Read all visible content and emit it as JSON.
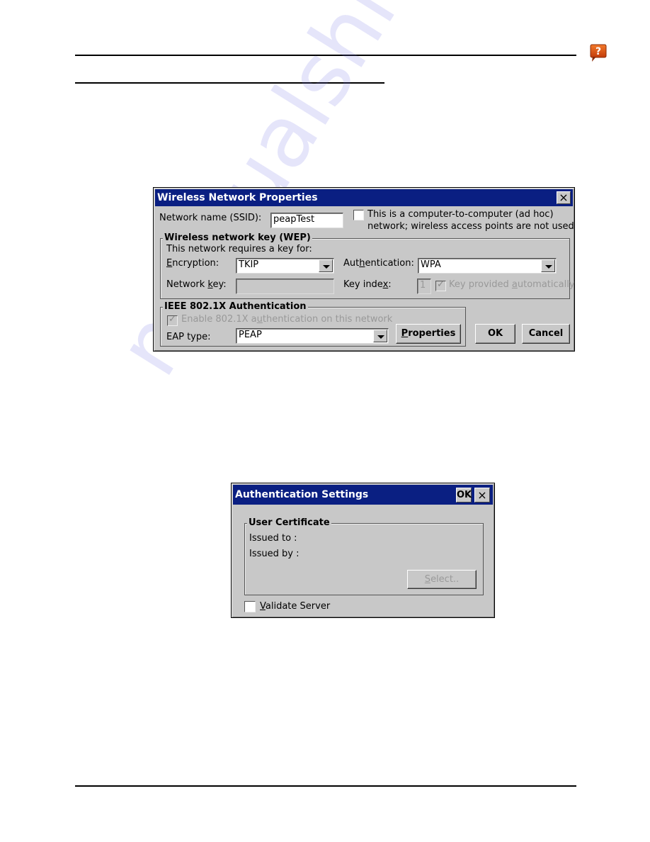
{
  "page": {
    "watermark": "manualshive.com",
    "help_icon": "help-question-icon"
  },
  "wireless_dialog": {
    "title": "Wireless Network Properties",
    "close_label": "×",
    "network_name_label": "Network name (SSID):",
    "network_name_value": "peapTest",
    "adhoc_checked": false,
    "adhoc_label_line1": "This is a computer-to-computer (ad hoc)",
    "adhoc_label_line2": "network; wireless access points are not used",
    "wep_group_title": "Wireless network key (WEP)",
    "requires_key_label": "This network requires a key for:",
    "encryption_label": "Encryption:",
    "encryption_value": "TKIP",
    "authentication_label": "Authentication:",
    "authentication_value": "WPA",
    "network_key_label": "Network key:",
    "network_key_value": "",
    "key_index_label": "Key index:",
    "key_index_value": "1",
    "key_auto_checked": true,
    "key_auto_label": "Key provided automatically",
    "ieee_group_title": "IEEE 802.1X Authentication",
    "enable_8021x_checked": true,
    "enable_8021x_label": "Enable 802.1X authentication on this network",
    "eap_type_label": "EAP type:",
    "eap_type_value": "PEAP",
    "properties_button": "Properties",
    "ok_button": "OK",
    "cancel_button": "Cancel"
  },
  "auth_dialog": {
    "title": "Authentication Settings",
    "ok_label": "OK",
    "close_label": "×",
    "group_title": "User Certificate",
    "issued_to_label": "Issued to :",
    "issued_by_label": "Issued by :",
    "select_button": "Select..",
    "validate_server_checked": false,
    "validate_server_label": "Validate Server"
  }
}
